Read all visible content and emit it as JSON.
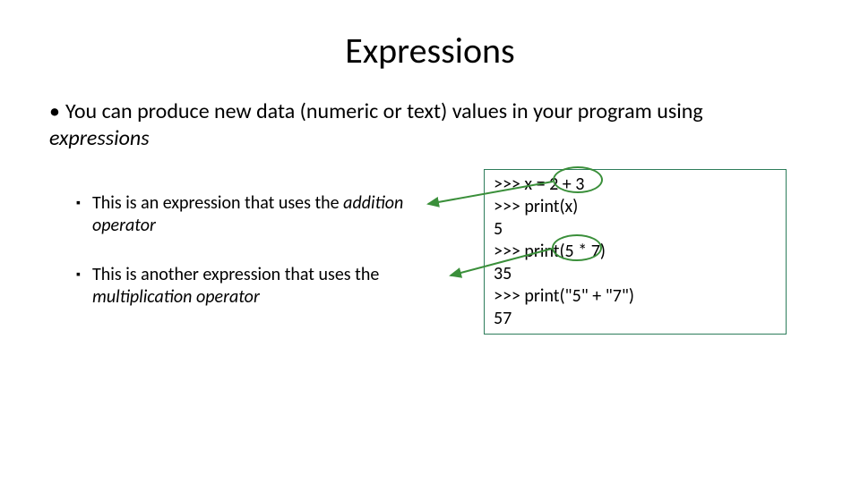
{
  "title": "Expressions",
  "main_bullet_pre": "You can produce new data (numeric or text) values in your program using ",
  "main_bullet_em": "expressions",
  "sub1_pre": "This is an expression that uses the ",
  "sub1_em": "addition operator",
  "sub2_pre": "This is another expression that uses the ",
  "sub2_em": "multiplication operator",
  "code": {
    "l1": ">>> x = 2 + 3",
    "l2": ">>> print(x)",
    "l3": "5",
    "l4": ">>> print(5 * 7)",
    "l5": "35",
    "l6": ">>> print(\"5\" + \"7\")",
    "l7": "57"
  },
  "colors": {
    "box_border": "#2e7d5b",
    "annotation": "#3a8f3a"
  }
}
